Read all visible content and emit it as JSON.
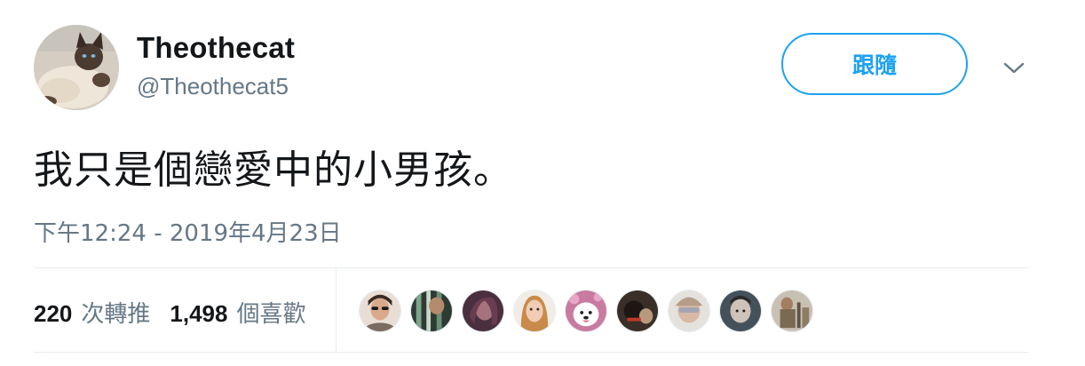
{
  "author": {
    "display_name": "Theothecat",
    "handle": "@Theothecat5",
    "avatar_icon": "siamese-cat-avatar"
  },
  "actions": {
    "follow_label": "跟隨",
    "more_icon": "chevron-down-icon"
  },
  "tweet": {
    "text": "我只是個戀愛中的小男孩。",
    "timestamp": "下午12:24 - 2019年4月23日"
  },
  "stats": {
    "retweets_count": "220",
    "retweets_label": "次轉推",
    "likes_count": "1,498",
    "likes_label": "個喜歡"
  },
  "likers": [
    {
      "icon": "liker-avatar-1"
    },
    {
      "icon": "liker-avatar-2"
    },
    {
      "icon": "liker-avatar-3"
    },
    {
      "icon": "liker-avatar-4"
    },
    {
      "icon": "liker-avatar-5"
    },
    {
      "icon": "liker-avatar-6"
    },
    {
      "icon": "liker-avatar-7"
    },
    {
      "icon": "liker-avatar-8"
    },
    {
      "icon": "liker-avatar-9"
    }
  ],
  "colors": {
    "accent": "#1da1f2",
    "text_primary": "#14171a",
    "text_secondary": "#657786",
    "divider": "#e6ecf0"
  }
}
